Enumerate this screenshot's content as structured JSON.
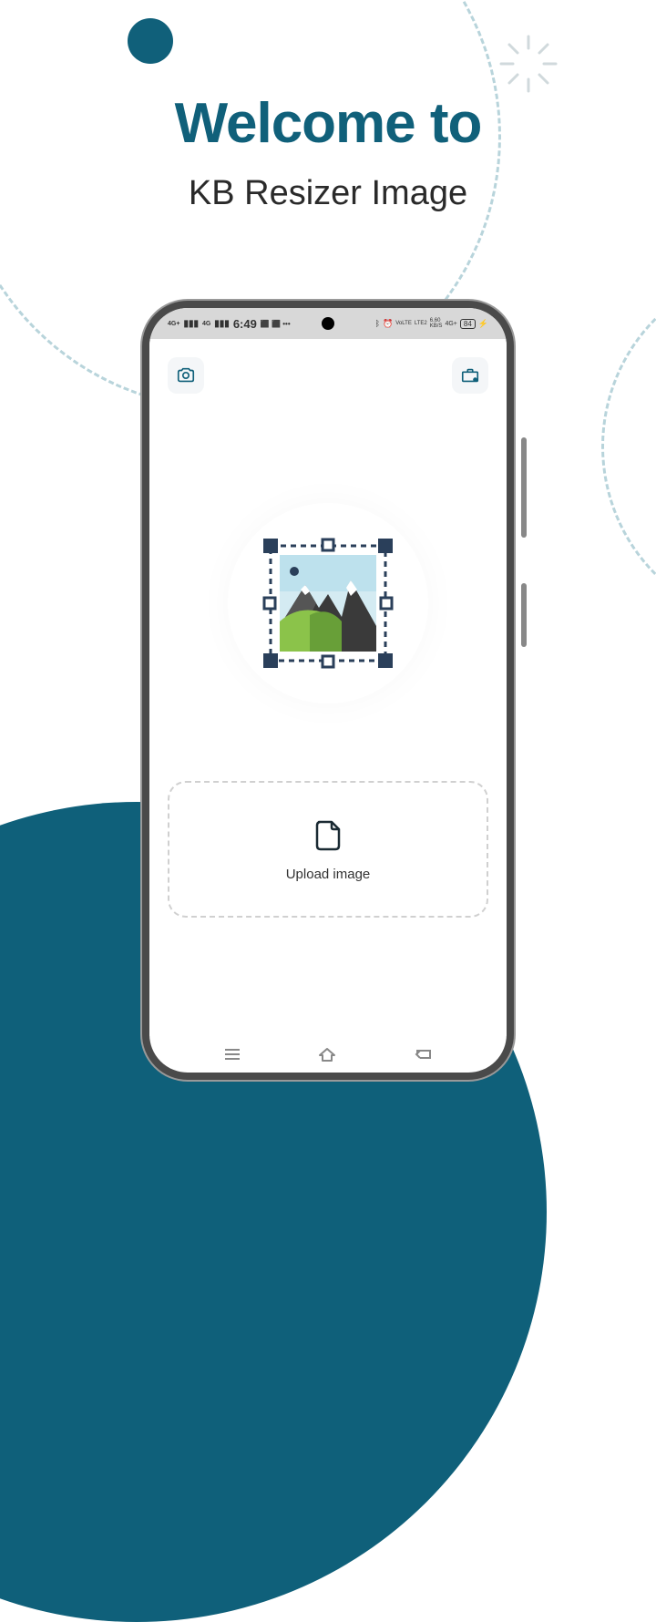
{
  "header": {
    "welcome": "Welcome to",
    "subtitle": "KB Resizer Image"
  },
  "statusbar": {
    "time": "6:49",
    "signal1": "4G+",
    "signal2": "4G",
    "right_net": "6.60",
    "right_kbs": "KB/S",
    "lte": "LTE2",
    "volte": "VoLTE",
    "net4g": "4G+",
    "battery": "84"
  },
  "app": {
    "upload_label": "Upload image"
  },
  "colors": {
    "primary": "#10607a",
    "dashed": "#b8d4db"
  }
}
